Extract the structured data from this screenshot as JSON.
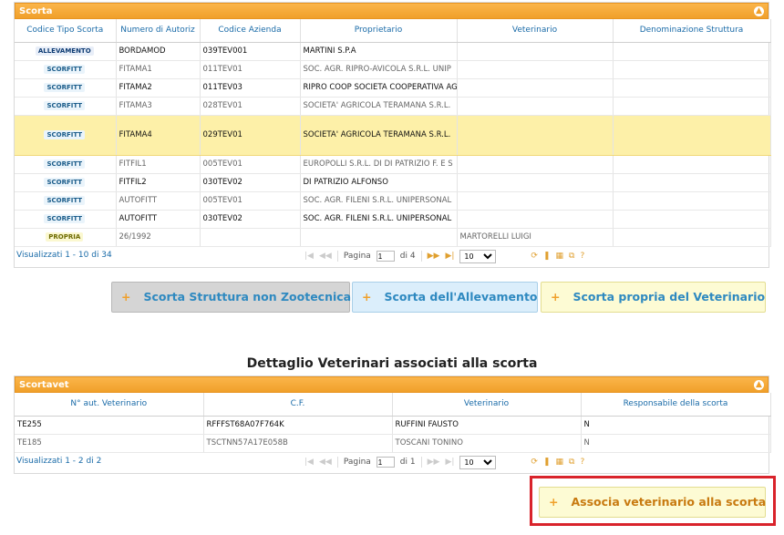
{
  "scorta_grid": {
    "title": "Scorta",
    "collapse_icon": "chevron-up-icon",
    "columns": [
      "Codice Tipo Scorta",
      "Numero di Autoriz",
      "Codice Azienda",
      "Proprietario",
      "Veterinario",
      "Denominazione Struttura"
    ],
    "rows": [
      {
        "tipo": "ALLEVAMENTO",
        "numero": "BORDAMOD",
        "codice": "039TEV001",
        "proprietario": "MARTINI S.P.A",
        "veterinario": "",
        "struttura": ""
      },
      {
        "tipo": "SCORFITT",
        "numero": "FITAMA1",
        "codice": "011TEV01",
        "proprietario": "SOC. AGR. RIPRO-AVICOLA S.R.L. UNIP",
        "veterinario": "",
        "struttura": ""
      },
      {
        "tipo": "SCORFITT",
        "numero": "FITAMA2",
        "codice": "011TEV03",
        "proprietario": "RIPRO COOP SOCIETA COOPERATIVA AG",
        "veterinario": "",
        "struttura": ""
      },
      {
        "tipo": "SCORFITT",
        "numero": "FITAMA3",
        "codice": "028TEV01",
        "proprietario": "SOCIETA' AGRICOLA TERAMANA S.R.L.",
        "veterinario": "",
        "struttura": ""
      },
      {
        "tipo": "SCORFITT",
        "numero": "FITAMA4",
        "codice": "029TEV01",
        "proprietario": "SOCIETA' AGRICOLA TERAMANA S.R.L.",
        "veterinario": "",
        "struttura": ""
      },
      {
        "tipo": "SCORFITT",
        "numero": "FITFIL1",
        "codice": "005TEV01",
        "proprietario": "EUROPOLLI S.R.L. DI DI PATRIZIO F. E S",
        "veterinario": "",
        "struttura": ""
      },
      {
        "tipo": "SCORFITT",
        "numero": "FITFIL2",
        "codice": "030TEV02",
        "proprietario": "DI PATRIZIO ALFONSO",
        "veterinario": "",
        "struttura": ""
      },
      {
        "tipo": "SCORFITT",
        "numero": "AUTOFITT",
        "codice": "005TEV01",
        "proprietario": "SOC. AGR. FILENI S.R.L. UNIPERSONAL",
        "veterinario": "",
        "struttura": ""
      },
      {
        "tipo": "SCORFITT",
        "numero": "AUTOFITT",
        "codice": "030TEV02",
        "proprietario": "SOC. AGR. FILENI S.R.L. UNIPERSONAL",
        "veterinario": "",
        "struttura": ""
      },
      {
        "tipo": "PROPRIA",
        "numero": "26/1992",
        "codice": "",
        "proprietario": "",
        "veterinario": "MARTORELLI LUIGI",
        "struttura": ""
      }
    ],
    "pager": {
      "info": "Visualizzati 1 - 10 di 34",
      "page_label": "Pagina",
      "page_value": "1",
      "of_label": "di 4",
      "page_size": "10",
      "page_size_options": [
        "10"
      ]
    }
  },
  "buttons": {
    "struttura": "Scorta Struttura non Zootecnica",
    "allevamento": "Scorta dell'Allevamento",
    "propria": "Scorta propria del Veterinario",
    "plus": "+"
  },
  "section_title": "Dettaglio Veterinari associati alla scorta",
  "vet_grid": {
    "title": "Scortavet",
    "collapse_icon": "chevron-up-icon",
    "columns": [
      "N° aut. Veterinario",
      "C.F.",
      "Veterinario",
      "Responsabile della scorta"
    ],
    "rows": [
      {
        "naut": "TE255",
        "cf": "RFFFST68A07F764K",
        "vet": "RUFFINI FAUSTO",
        "resp": "N"
      },
      {
        "naut": "TE185",
        "cf": "TSCTNN57A17E058B",
        "vet": "TOSCANI TONINO",
        "resp": "N"
      }
    ],
    "pager": {
      "info": "Visualizzati 1 - 2 di 2",
      "page_label": "Pagina",
      "page_value": "1",
      "of_label": "di 1",
      "page_size": "10",
      "page_size_options": [
        "10"
      ]
    }
  },
  "associa_button": "Associa veterinario alla scorta",
  "icons": {
    "first": "first-page-icon",
    "prev": "prev-page-icon",
    "next": "next-page-icon",
    "last": "last-page-icon",
    "refresh": "refresh-icon",
    "columns": "columns-icon",
    "export": "export-icon",
    "help": "help-icon"
  },
  "colors": {
    "accent": "#f0a02a",
    "link": "#1a6ba8",
    "highlight": "#d9232b",
    "selected_row": "#fdf0a8"
  }
}
